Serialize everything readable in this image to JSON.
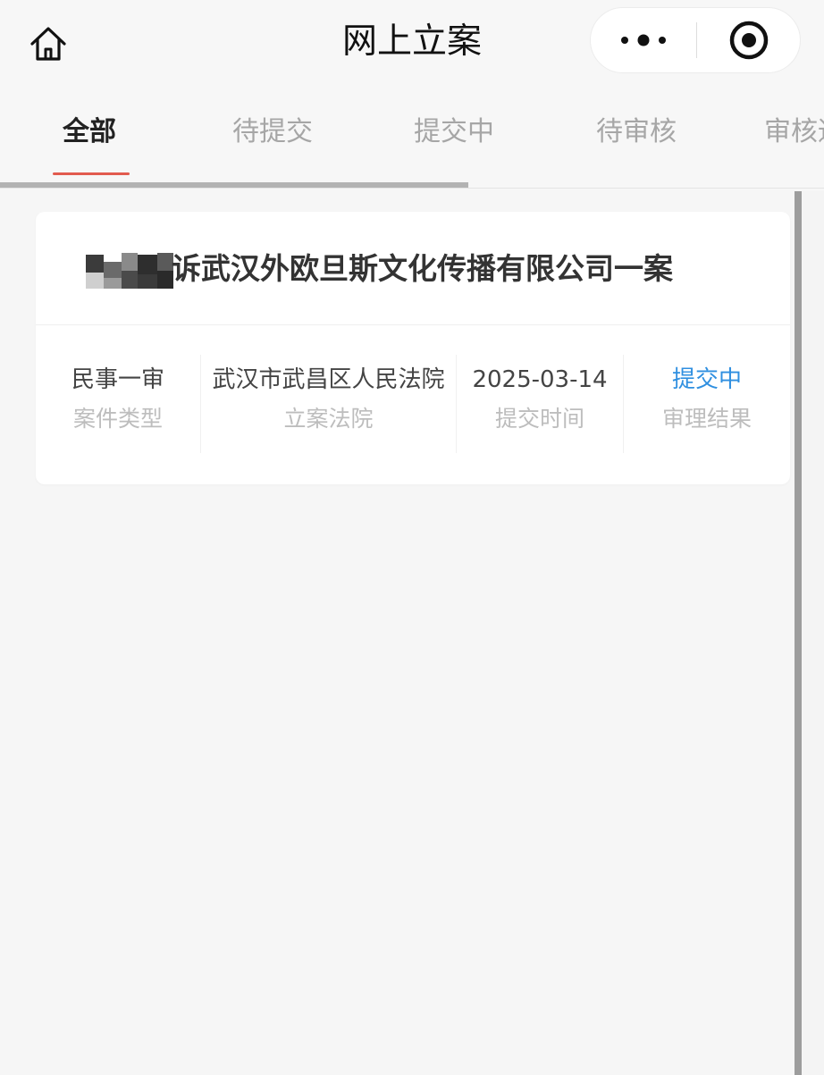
{
  "navbar": {
    "title": "网上立案",
    "home_icon": "home-icon",
    "more_icon": "more-dots-icon",
    "close_icon": "target-circle-icon"
  },
  "tabs": [
    {
      "label": "全部",
      "active": true
    },
    {
      "label": "待提交",
      "active": false
    },
    {
      "label": "提交中",
      "active": false
    },
    {
      "label": "待审核",
      "active": false
    },
    {
      "label": "审核通",
      "active": false
    }
  ],
  "colors": {
    "accent_underline": "#e25b4f",
    "status_blue": "#2f8fe0",
    "background": "#f6f6f6"
  },
  "case": {
    "title": "诉武汉外欧旦斯文化传播有限公司一案",
    "type_value": "民事一审",
    "type_label": "案件类型",
    "court_value": "武汉市武昌区人民法院",
    "court_label": "立案法院",
    "time_value": "2025-03-14",
    "time_label": "提交时间",
    "result_value": "提交中",
    "result_label": "审理结果"
  }
}
